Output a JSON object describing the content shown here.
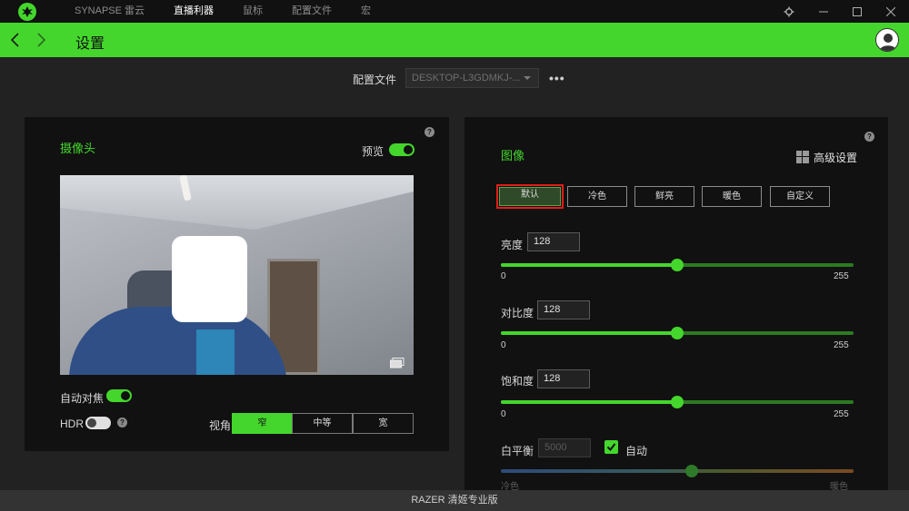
{
  "titlebar": {
    "nav": [
      "SYNAPSE 雷云",
      "直播利器",
      "鼠标",
      "配置文件",
      "宏"
    ],
    "active_index": 1
  },
  "header": {
    "title": "设置"
  },
  "profile": {
    "label": "配置文件",
    "value": "DESKTOP-L3GDMKJ-...",
    "more": "•••"
  },
  "camera": {
    "title": "摄像头",
    "preview_label": "预览",
    "preview_on": true,
    "autofocus_label": "自动对焦",
    "autofocus_on": true,
    "hdr_label": "HDR",
    "hdr_on": false,
    "fov_label": "视角",
    "fov_options": [
      "窄",
      "中等",
      "宽"
    ],
    "fov_selected": "窄"
  },
  "image": {
    "title": "图像",
    "advanced_label": "高级设置",
    "presets": [
      "默认",
      "冷色",
      "鲜亮",
      "暖色",
      "自定义"
    ],
    "preset_selected": "默认",
    "brightness": {
      "label": "亮度",
      "value": "128",
      "min": "0",
      "max": "255"
    },
    "contrast": {
      "label": "对比度",
      "value": "128",
      "min": "0",
      "max": "255"
    },
    "saturation": {
      "label": "饱和度",
      "value": "128",
      "min": "0",
      "max": "255"
    },
    "white_balance": {
      "label": "白平衡",
      "value": "5000",
      "auto_label": "自动",
      "auto_checked": true,
      "min_label": "冷色",
      "max_label": "暖色"
    }
  },
  "footer": {
    "text": "RAZER 清姬专业版"
  },
  "colors": {
    "accent": "#44d62c",
    "selected_outline": "#e41b1b",
    "panel": "#111111",
    "background": "#222222"
  }
}
